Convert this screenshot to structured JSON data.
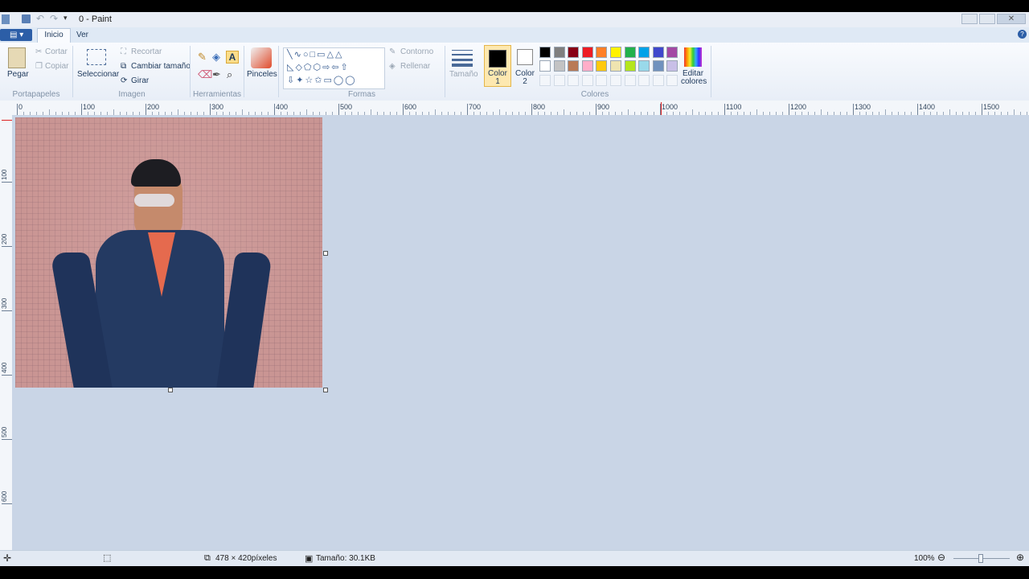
{
  "window": {
    "title": "0 - Paint"
  },
  "tabs": {
    "home": "Inicio",
    "view": "Ver"
  },
  "ribbon": {
    "clipboard": {
      "paste": "Pegar",
      "cut": "Cortar",
      "copy": "Copiar",
      "group": "Portapapeles"
    },
    "image": {
      "select": "Seleccionar",
      "crop": "Recortar",
      "resize": "Cambiar tamaño",
      "rotate": "Girar",
      "group": "Imagen"
    },
    "tools": {
      "group": "Herramientas"
    },
    "brushes": {
      "label": "Pinceles"
    },
    "shapes": {
      "outline": "Contorno",
      "fill": "Rellenar",
      "group": "Formas"
    },
    "size": {
      "label": "Tamaño"
    },
    "colors": {
      "color1": "Color 1",
      "color2": "Color 2",
      "edit": "Editar colores",
      "group": "Colores",
      "color1_value": "#000000",
      "color2_value": "#ffffff",
      "row1": [
        "#000000",
        "#7f7f7f",
        "#880015",
        "#ed1c24",
        "#ff7f27",
        "#fff200",
        "#22b14c",
        "#00a2e8",
        "#3f48cc",
        "#a349a4"
      ],
      "row2": [
        "#ffffff",
        "#c3c3c3",
        "#b97a57",
        "#ffaec9",
        "#ffc90e",
        "#efe4b0",
        "#b5e61d",
        "#99d9ea",
        "#7092be",
        "#c8bfe7"
      ]
    }
  },
  "ruler": {
    "top": [
      "0",
      "100",
      "200",
      "300",
      "400",
      "500",
      "600",
      "700",
      "800",
      "900",
      "1000",
      "1100",
      "1200",
      "1300",
      "1400",
      "1500"
    ],
    "left": [
      "100",
      "200",
      "300",
      "400",
      "500",
      "600"
    ]
  },
  "status": {
    "dimensions": "478 × 420píxeles",
    "file_size": "Tamaño: 30.1KB",
    "zoom": "100%"
  }
}
